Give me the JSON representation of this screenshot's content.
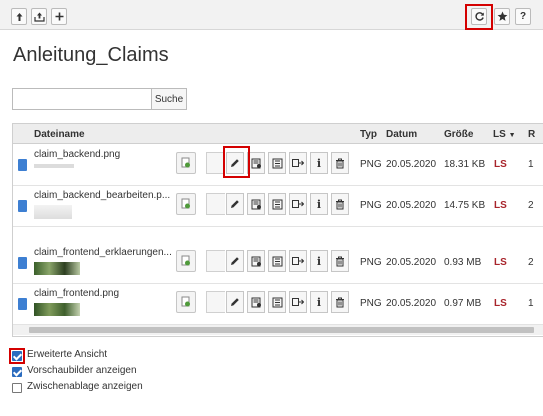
{
  "title": "Anleitung_Claims",
  "search": {
    "placeholder": "",
    "button_label": "Suche"
  },
  "toolbar": {
    "left_icons": [
      "upload-up-icon",
      "upload-folder-icon",
      "plus-icon"
    ],
    "right_icons": [
      "refresh-icon",
      "star-icon",
      "help-icon"
    ],
    "help_label": "?"
  },
  "table": {
    "columns": [
      "Dateiname",
      "Typ",
      "Datum",
      "Größe",
      "LS",
      "R"
    ],
    "rows": [
      {
        "name": "claim_backend.png",
        "type": "PNG",
        "date": "20.05.2020",
        "size": "18.31 KB",
        "ls": "LS",
        "r": "1"
      },
      {
        "name": "claim_backend_bearbeiten.p...",
        "type": "PNG",
        "date": "20.05.2020",
        "size": "14.75 KB",
        "ls": "LS",
        "r": "2"
      },
      {
        "name": "claim_frontend_erklaerungen...",
        "type": "PNG",
        "date": "20.05.2020",
        "size": "0.93 MB",
        "ls": "LS",
        "r": "2"
      },
      {
        "name": "claim_frontend.png",
        "type": "PNG",
        "date": "20.05.2020",
        "size": "0.97 MB",
        "ls": "LS",
        "r": "1"
      }
    ],
    "action_icons": [
      "pencil-icon",
      "file-edit-icon",
      "view-icon",
      "move-icon",
      "info-icon",
      "trash-icon"
    ],
    "info_label": "i"
  },
  "options": [
    {
      "label": "Erweiterte Ansicht",
      "checked": true
    },
    {
      "label": "Vorschaubilder anzeigen",
      "checked": true
    },
    {
      "label": "Zwischenablage anzeigen",
      "checked": false
    }
  ],
  "colors": {
    "ls": "#a8242b",
    "highlight": "#d40000",
    "checkbox": "#2b6cbf"
  }
}
